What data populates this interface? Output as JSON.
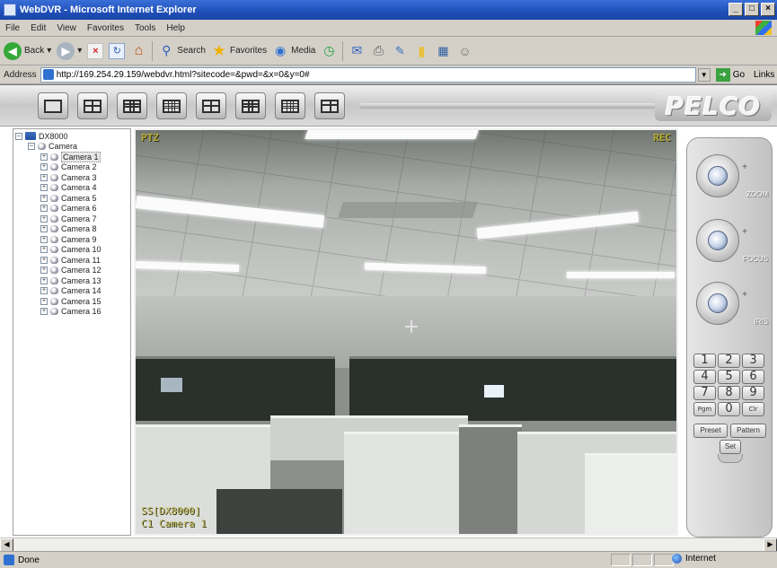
{
  "window": {
    "title": "WebDVR - Microsoft Internet Explorer",
    "min": "_",
    "max": "□",
    "close": "×"
  },
  "menu": [
    "File",
    "Edit",
    "View",
    "Favorites",
    "Tools",
    "Help"
  ],
  "toolbar": {
    "back": "Back",
    "search": "Search",
    "favorites": "Favorites",
    "media": "Media"
  },
  "address": {
    "label": "Address",
    "url": "http://169.254.29.159/webdvr.html?sitecode=&pwd=&x=0&y=0#",
    "go": "Go",
    "links": "Links"
  },
  "brand": "PELCO",
  "tree": {
    "root": "DX8000",
    "group": "Camera",
    "items": [
      "Camera 1",
      "Camera 2",
      "Camera 3",
      "Camera 4",
      "Camera 5",
      "Camera 6",
      "Camera 7",
      "Camera 8",
      "Camera 9",
      "Camera 10",
      "Camera 11",
      "Camera 12",
      "Camera 13",
      "Camera 14",
      "Camera 15",
      "Camera 16"
    ],
    "selected_index": 0
  },
  "video": {
    "ptz": "PTZ",
    "rec": "REC",
    "line1": "SS[DX8000]",
    "line2": "C1 Camera 1"
  },
  "control": {
    "zoom": "ZOOM",
    "focus": "FOCUS",
    "iris": "IRIS",
    "keys": [
      "1",
      "2",
      "3",
      "4",
      "5",
      "6",
      "7",
      "8",
      "9",
      "Pgm",
      "0",
      "Clr"
    ],
    "preset": "Preset",
    "pattern": "Pattern",
    "set": "Set"
  },
  "status": {
    "text": "Done",
    "zone": "Internet"
  }
}
